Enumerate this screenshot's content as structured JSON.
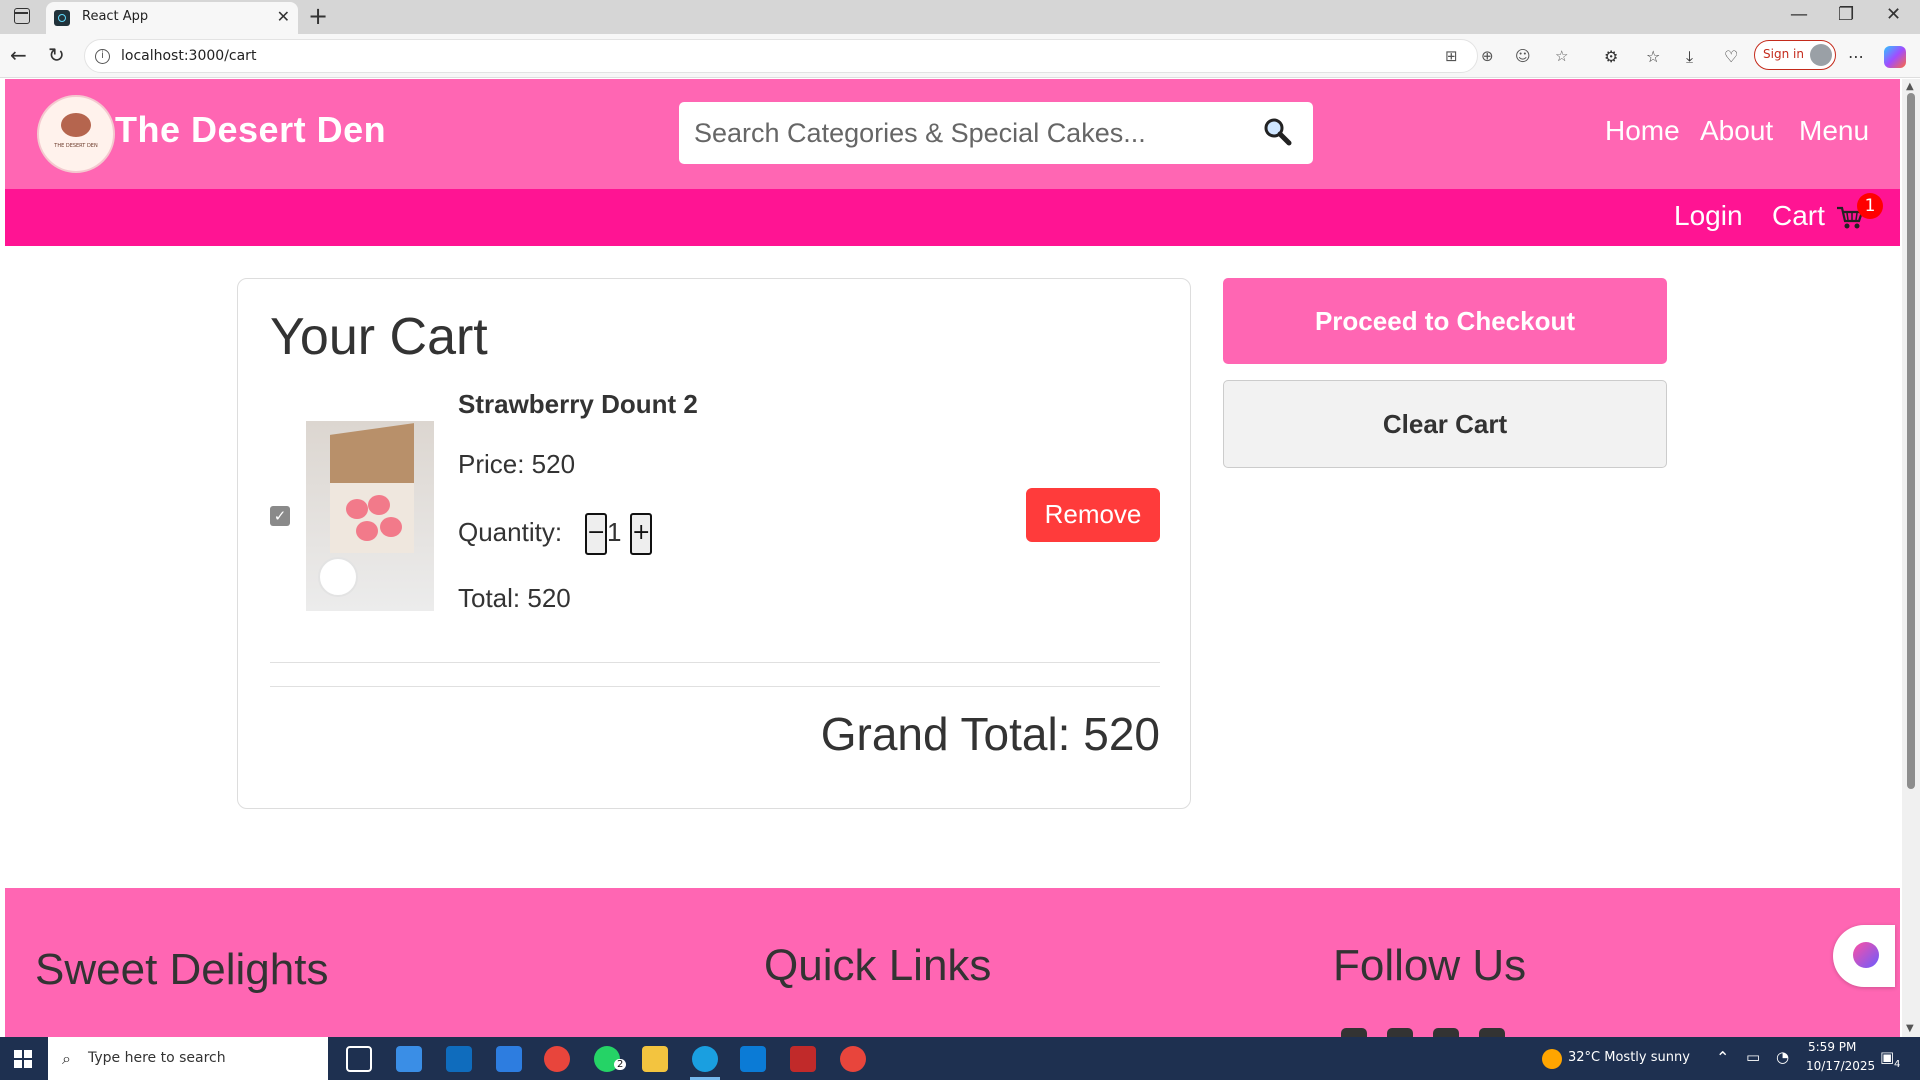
{
  "browser": {
    "tab_title": "React App",
    "url": "localhost:3000/cart",
    "sign_in": "Sign in"
  },
  "header": {
    "brand": "The Desert Den",
    "logo_text": "THE DESERT DEN",
    "search_placeholder": "Search Categories & Special Cakes...",
    "nav": [
      "Home",
      "About",
      "Menu"
    ],
    "login": "Login",
    "cart": "Cart",
    "cart_count": "1"
  },
  "cart": {
    "title": "Your Cart",
    "items": [
      {
        "name": "Strawberry Dount 2",
        "price": "Price: 520",
        "quantity_label": "Quantity:",
        "quantity": "1",
        "decrement": "−",
        "increment": "+",
        "total": "Total: 520",
        "checked": true,
        "remove_label": "Remove"
      }
    ],
    "grand_total": "Grand Total: 520"
  },
  "actions": {
    "checkout": "Proceed to Checkout",
    "clear": "Clear Cart"
  },
  "footer": {
    "col1_title": "Sweet Delights",
    "col2_title": "Quick Links",
    "col3_title": "Follow Us"
  },
  "taskbar": {
    "search_placeholder": "Type here to search",
    "weather": "32°C  Mostly sunny",
    "time": "5:59 PM",
    "date": "10/17/2025",
    "notifications": "4",
    "whatsapp_badge": "2"
  },
  "colors": {
    "header_pink": "#ff66b3",
    "subheader_pink": "#ff1493",
    "remove_red": "#ff3b3b",
    "badge_red": "#ff0000"
  }
}
